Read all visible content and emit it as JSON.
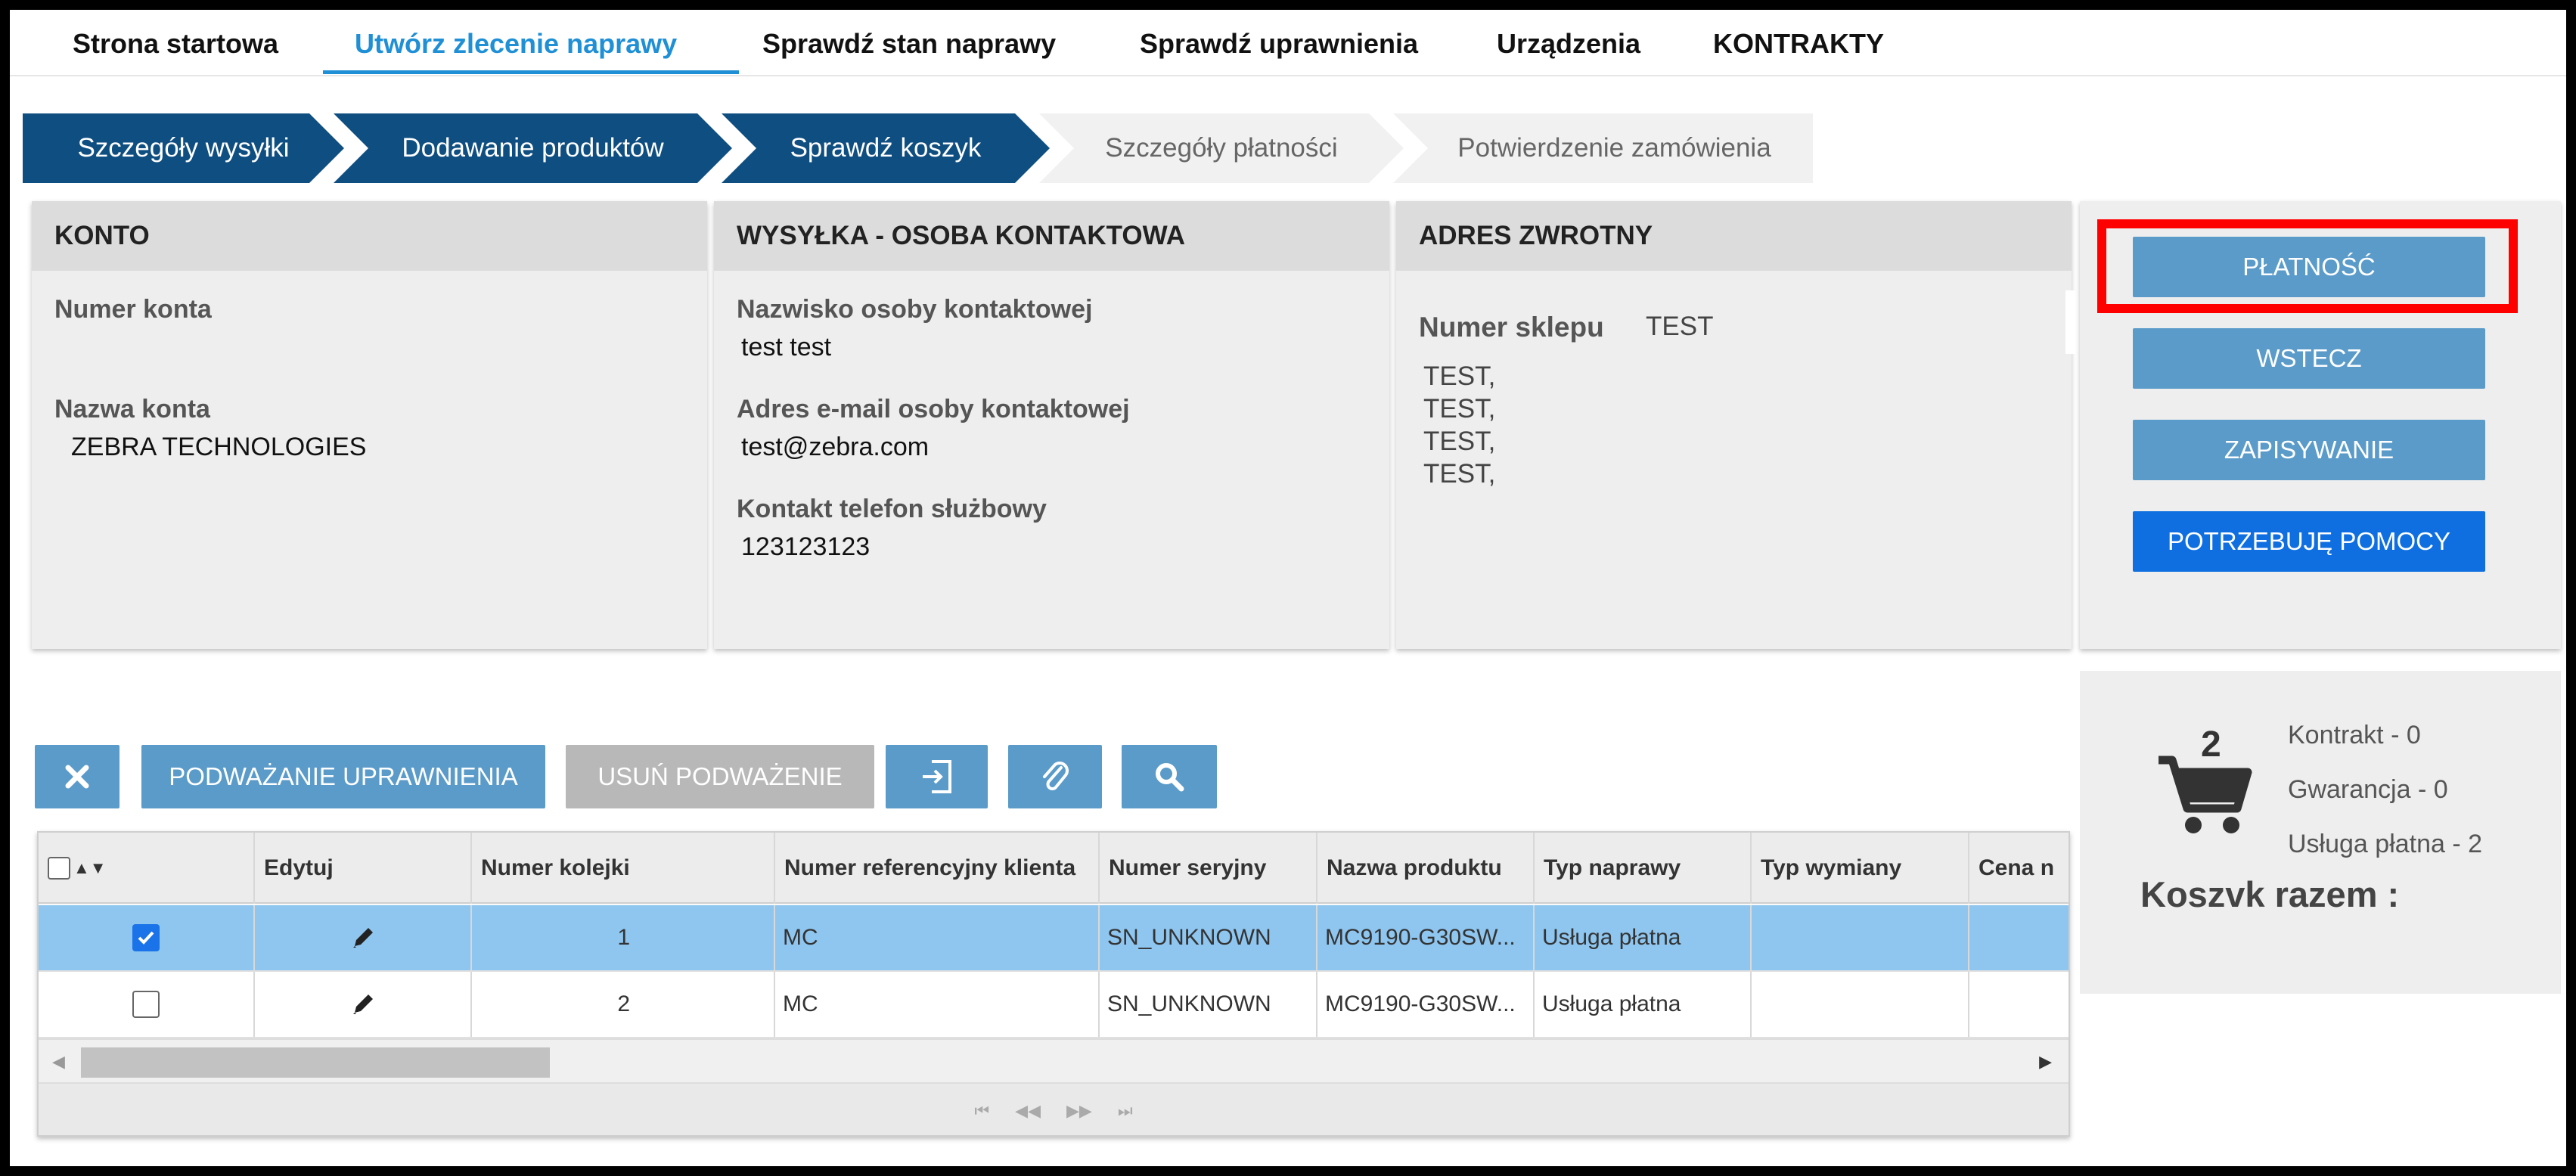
{
  "nav": {
    "items": [
      "Strona startowa",
      "Utwórz zlecenie naprawy",
      "Sprawdź stan naprawy",
      "Sprawdź uprawnienia",
      "Urządzenia",
      "KONTRAKTY"
    ],
    "active_index": 1
  },
  "wizard": {
    "steps": [
      "Szczegóły wysyłki",
      "Dodawanie produktów",
      "Sprawdź koszyk",
      "Szczegóły płatności",
      "Potwierdzenie zamówienia"
    ],
    "completed_count": 3
  },
  "account": {
    "title": "KONTO",
    "number_label": "Numer konta",
    "number_value": "",
    "name_label": "Nazwa konta",
    "name_value": "ZEBRA TECHNOLOGIES"
  },
  "shipping_contact": {
    "title": "WYSYŁKA - OSOBA KONTAKTOWA",
    "surname_label": "Nazwisko osoby kontaktowej",
    "surname_value": "test test",
    "email_label": "Adres e-mail osoby kontaktowej",
    "email_value": "test@zebra.com",
    "phone_label": "Kontakt telefon służbowy",
    "phone_value": "123123123"
  },
  "return_address": {
    "title": "ADRES ZWROTNY",
    "store_label": "Numer sklepu",
    "store_value": "TEST",
    "lines": [
      "TEST,",
      "TEST,",
      "TEST,",
      "TEST,"
    ]
  },
  "actions": {
    "payment": "PŁATNOŚĆ",
    "back": "WSTECZ",
    "save": "ZAPISYWANIE",
    "help": "POTRZEBUJĘ POMOCY"
  },
  "cart": {
    "count": "2",
    "contract": "Kontrakt - 0",
    "warranty": "Gwarancja - 0",
    "paid_service": "Usługa płatna - 2",
    "total_label": "Koszvk razem :"
  },
  "toolbar": {
    "challenge_entitlement": "PODWAŻANIE UPRAWNIENIA",
    "remove_challenge": "USUŃ PODWAŻENIE"
  },
  "grid": {
    "columns": [
      "",
      "Edytuj",
      "Numer kolejki",
      "Numer referencyjny klienta",
      "Numer seryjny",
      "Nazwa produktu",
      "Typ naprawy",
      "Typ wymiany",
      "Cena n"
    ],
    "rows": [
      {
        "checked": true,
        "queue": "1",
        "client_ref": "MC",
        "serial": "SN_UNKNOWN",
        "product": "MC9190-G30SW...",
        "repair_type": "Usługa płatna",
        "exchange_type": "",
        "price": ""
      },
      {
        "checked": false,
        "queue": "2",
        "client_ref": "MC",
        "serial": "SN_UNKNOWN",
        "product": "MC9190-G30SW...",
        "repair_type": "Usługa płatna",
        "exchange_type": "",
        "price": ""
      }
    ]
  },
  "colors": {
    "accent": "#1f8fd6",
    "wizard_done": "#0f4e80",
    "button": "#5a9bc9",
    "help_button": "#0f6fe0",
    "highlight": "#ff0000",
    "selected_row": "#8ec6f0"
  }
}
